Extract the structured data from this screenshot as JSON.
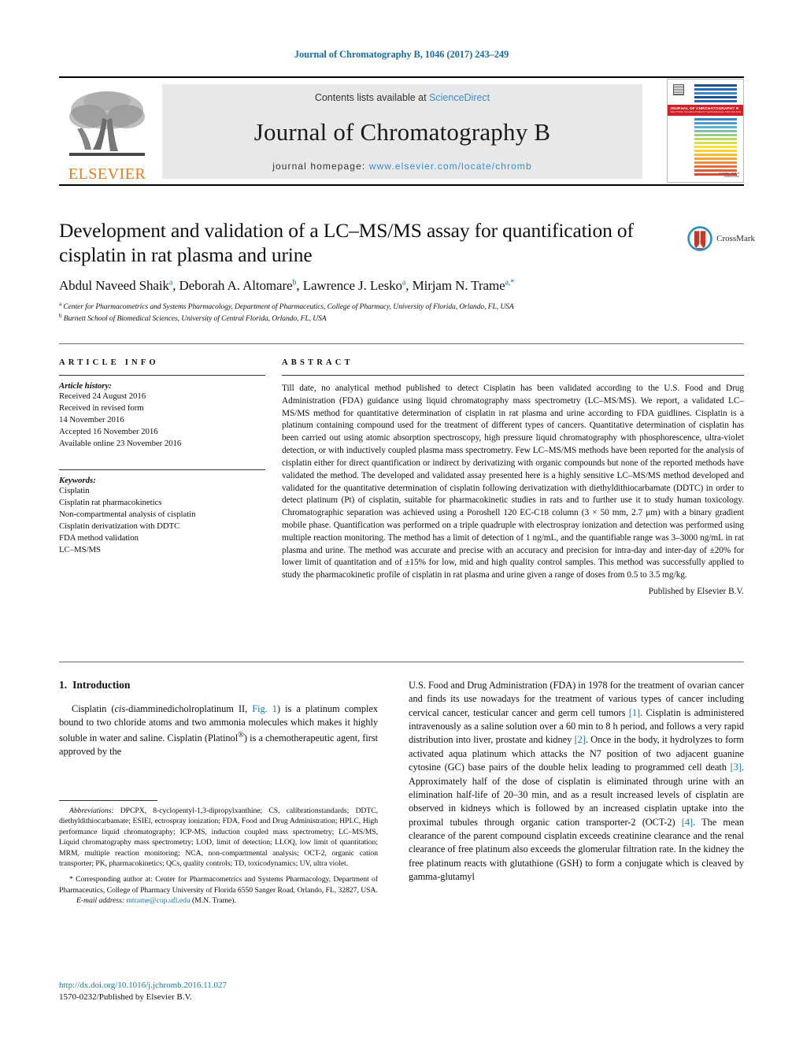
{
  "running_head": "Journal of Chromatography B, 1046 (2017) 243–249",
  "masthead": {
    "contents_prefix": "Contents lists available at ",
    "sciencedirect": "ScienceDirect",
    "journal_name": "Journal of Chromatography B",
    "homepage_prefix": "journal homepage: ",
    "homepage_url": "www.elsevier.com/locate/chromb",
    "publisher_wordmark": "ELSEVIER",
    "cover": {
      "title": "JOURNAL OF CHROMATOGRAPHY B",
      "subtitle": "ANALYTICAL TECHNOLOGIES IN THE BIOMEDICAL AND LIFE SCIENCES",
      "mark_small": "Available online at",
      "mark": "ScienceDirect"
    },
    "colors": {
      "link": "#3b8ec6",
      "band": "#e7e8ea",
      "elsevier_orange": "#E87B1E",
      "cover_red": "#cf2127"
    }
  },
  "article": {
    "title": "Development and validation of a LC–MS/MS assay for quantification of cisplatin in rat plasma and urine",
    "authors": "Abdul Naveed Shaik a , Deborah A. Altomare b , Lawrence J. Lesko a , Mirjam N. Trame a,*",
    "author_list": [
      {
        "name": "Abdul Naveed Shaik",
        "sup": "a"
      },
      {
        "name": "Deborah A. Altomare",
        "sup": "b"
      },
      {
        "name": "Lawrence J. Lesko",
        "sup": "a"
      },
      {
        "name": "Mirjam N. Trame",
        "sup": "a,*"
      }
    ],
    "affiliations": [
      {
        "sup": "a",
        "text": "Center for Pharmacometrics and Systems Pharmacology, Department of Pharmaceutics, College of Pharmacy, University of Florida, Orlando, FL, USA"
      },
      {
        "sup": "b",
        "text": "Burnett School of Biomedical Sciences, University of Central Florida, Orlando, FL, USA"
      }
    ],
    "crossmark_label": "CrossMark"
  },
  "info": {
    "heading": "ARTICLE INFO",
    "history_label": "Article history:",
    "history_lines": [
      "Received 24 August 2016",
      "Received in revised form",
      "14 November 2016",
      "Accepted 16 November 2016",
      "Available online 23 November 2016"
    ],
    "keywords_label": "Keywords:",
    "keywords": [
      "Cisplatin",
      "Cisplatin rat pharmacokinetics",
      "Non-compartmental analysis of cisplatin",
      "Cisplatin derivatization with DDTC",
      "FDA method validation",
      "LC–MS/MS"
    ]
  },
  "abstract": {
    "heading": "ABSTRACT",
    "text": "Till date, no analytical method published to detect Cisplatin has been validated according to the U.S. Food and Drug Administration (FDA) guidance using liquid chromatography mass spectrometry (LC–MS/MS). We report, a validated LC–MS/MS method for quantitative determination of cisplatin in rat plasma and urine according to FDA guidlines. Cisplatin is a platinum containing compound used for the treatment of different types of cancers. Quantitative determination of cisplatin has been carried out using atomic absorption spectroscopy, high pressure liquid chromatography with phosphorescence, ultra-violet detection, or with inductively coupled plasma mass spectrometry. Few LC–MS/MS methods have been reported for the analysis of cisplatin either for direct quantification or indirect by derivatizing with organic compounds but none of the reported methods have validated the method. The developed and validated assay presented here is a highly sensitive LC–MS/MS method developed and validated for the quantitative determination of cisplatin following derivatization with diethyldithiocarbamate (DDTC) in order to detect platinum (Pt) of cisplatin, suitable for pharmacokinetic studies in rats and to further use it to study human toxicology. Chromatographic separation was achieved using a Poroshell 120 EC-C18 column (3 × 50 mm, 2.7 μm) with a binary gradient mobile phase. Quantification was performed on a triple quadruple with electrospray ionization and detection was performed using multiple reaction monitoring. The method has a limit of detection of 1 ng/mL, and the quantifiable range was 3–3000 ng/mL in rat plasma and urine. The method was accurate and precise with an accuracy and precision for intra-day and inter-day of ±20% for lower limit of quantitation and of ±15% for low, mid and high quality control samples. This method was successfully applied to study the pharmacokinetic profile of cisplatin in rat plasma and urine given a range of doses from 0.5 to 3.5 mg/kg.",
    "publisher": "Published by Elsevier B.V."
  },
  "introduction": {
    "number": "1.",
    "heading": "Introduction",
    "left_paragraph_1": "Cisplatin (cis-diamminedicholroplatinum II, Fig. 1) is a platinum complex bound to two chloride atoms and two ammonia molecules which makes it highly soluble in water and saline. Cisplatin (Platinol®) is a chemotherapeutic agent, first approved by the",
    "left_link": "Fig. 1",
    "right_paragraph": "U.S. Food and Drug Administration (FDA) in 1978 for the treatment of ovarian cancer and finds its use nowadays for the treatment of various types of cancer including cervical cancer, testicular cancer and germ cell tumors [1]. Cisplatin is administered intravenously as a saline solution over a 60 min to 8 h period, and follows a very rapid distribution into liver, prostate and kidney [2]. Once in the body, it hydrolyzes to form activated aqua platinum which attacks the N7 position of two adjacent guanine cytosine (GC) base pairs of the double helix leading to programmed cell death [3]. Approximately half of the dose of cisplatin is eliminated through urine with an elimination half-life of 20–30 min, and as a result increased levels of cisplatin are observed in kidneys which is followed by an increased cisplatin uptake into the proximal tubules through organic cation transporter-2 (OCT-2) [4]. The mean clearance of the parent compound cisplatin exceeds creatinine clearance and the renal clearance of free platinum also exceeds the glomerular filtration rate. In the kidney the free platinum reacts with glutathione (GSH) to form a conjugate which is cleaved by gamma-glutamyl",
    "citations": [
      "[1]",
      "[2]",
      "[3]",
      "[4]"
    ]
  },
  "footnotes": {
    "abbreviations_label": "Abbreviations:",
    "abbreviations_text": " DPCPX, 8-cyclopentyl-1,3-dipropylxanthine; CS, calibrationstandards; DDTC, diethyldithiocarbamate; ESIEl, ectrospray ionization; FDA, Food and Drug Administration; HPLC, High performance liquid chromatography; ICP-MS, induction coupled mass spectrometry; LC–MS/MS, Liquid chromatography mass spectrometry; LOD, limit of detection; LLOQ, low limit of quantitation; MRM, multiple reaction monitoring; NCA, non-compartmental analysis; OCT-2, organic cation transporter; PK, pharmacokinetics; QCs, quality controls; TD, toxicodynamics; UV, ultra violet.",
    "corresponding_marker": "*",
    "corresponding_text": " Corresponding author at: Center for Pharmacometrics and Systems Pharmacology, Department of Pharmaceutics, College of Pharmacy University of Florida 6550 Sanger Road, Orlando, FL, 32827, USA.",
    "email_label": "E-mail address:",
    "email": "mtrame@cop.ufl.edu",
    "email_owner": " (M.N. Trame)."
  },
  "footer": {
    "doi": "http://dx.doi.org/10.1016/j.jchromb.2016.11.027",
    "issn": "1570-0232/Published by Elsevier B.V."
  }
}
